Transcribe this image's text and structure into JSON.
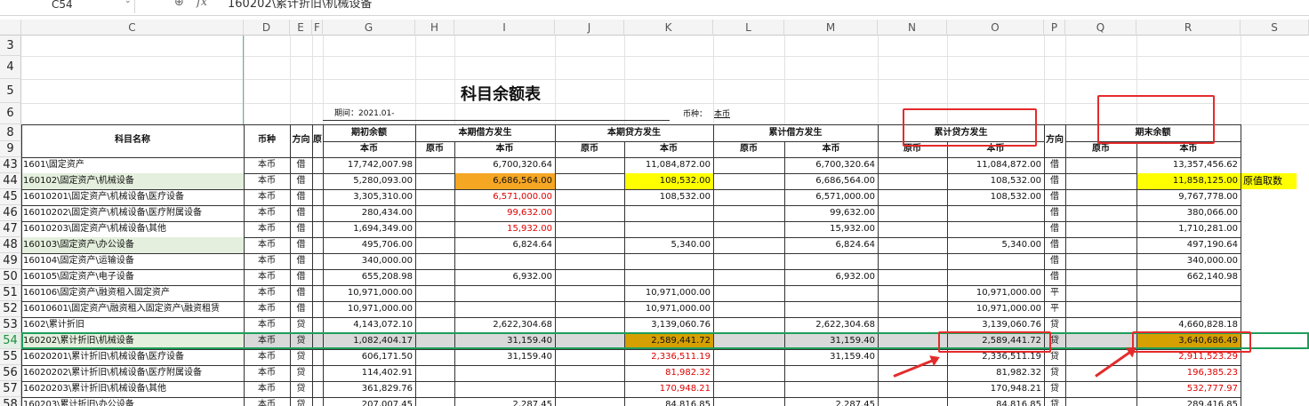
{
  "formula_bar": {
    "name_box": "C54",
    "formula": "160202\\累计折旧\\机械设备"
  },
  "columns": [
    "C",
    "D",
    "E",
    "F",
    "G",
    "H",
    "I",
    "J",
    "K",
    "L",
    "M",
    "N",
    "O",
    "P",
    "Q",
    "R",
    "S"
  ],
  "title": "科目余额表",
  "period_label": "期间：2021.01-",
  "currency_label": "币种：",
  "currency_value": "本币",
  "headers": {
    "subject_name": "科目名称",
    "currency": "币种",
    "direction": "方向",
    "direction2": "方向",
    "f_col": "原",
    "opening": "期初余额",
    "period_debit": "本期借方发生",
    "period_credit": "本期贷方发生",
    "cum_debit": "累计借方发生",
    "cum_credit": "累计贷方发生",
    "closing": "期末余额",
    "orig": "原币",
    "local": "本币"
  },
  "row_numbers_top": [
    "3",
    "4",
    "5",
    "6",
    "8",
    "9"
  ],
  "rows": [
    {
      "n": "43",
      "name": "1601\\固定资产",
      "cur": "本币",
      "dir": "借",
      "g": "17,742,007.98",
      "i": "6,700,320.64",
      "k": "11,084,872.00",
      "m": "6,700,320.64",
      "o": "11,084,872.00",
      "p": "借",
      "r": "13,357,456.62"
    },
    {
      "n": "44",
      "name": "160102\\固定资产\\机械设备",
      "cur": "本币",
      "dir": "借",
      "g": "5,280,093.00",
      "i": "6,686,564.00",
      "k": "108,532.00",
      "m": "6,686,564.00",
      "o": "108,532.00",
      "p": "借",
      "r": "11,858,125.00"
    },
    {
      "n": "45",
      "name": "16010201\\固定资产\\机械设备\\医疗设备",
      "cur": "本币",
      "dir": "借",
      "g": "3,305,310.00",
      "i": "6,571,000.00",
      "k": "108,532.00",
      "m": "6,571,000.00",
      "o": "108,532.00",
      "p": "借",
      "r": "9,767,778.00"
    },
    {
      "n": "46",
      "name": "16010202\\固定资产\\机械设备\\医疗附属设备",
      "cur": "本币",
      "dir": "借",
      "g": "280,434.00",
      "i": "99,632.00",
      "k": "",
      "m": "99,632.00",
      "o": "",
      "p": "借",
      "r": "380,066.00"
    },
    {
      "n": "47",
      "name": "16010203\\固定资产\\机械设备\\其他",
      "cur": "本币",
      "dir": "借",
      "g": "1,694,349.00",
      "i": "15,932.00",
      "k": "",
      "m": "15,932.00",
      "o": "",
      "p": "借",
      "r": "1,710,281.00"
    },
    {
      "n": "48",
      "name": "160103\\固定资产\\办公设备",
      "cur": "本币",
      "dir": "借",
      "g": "495,706.00",
      "i": "6,824.64",
      "k": "5,340.00",
      "m": "6,824.64",
      "o": "5,340.00",
      "p": "借",
      "r": "497,190.64"
    },
    {
      "n": "49",
      "name": "160104\\固定资产\\运输设备",
      "cur": "本币",
      "dir": "借",
      "g": "340,000.00",
      "i": "",
      "k": "",
      "m": "",
      "o": "",
      "p": "借",
      "r": "340,000.00"
    },
    {
      "n": "50",
      "name": "160105\\固定资产\\电子设备",
      "cur": "本币",
      "dir": "借",
      "g": "655,208.98",
      "i": "6,932.00",
      "k": "",
      "m": "6,932.00",
      "o": "",
      "p": "借",
      "r": "662,140.98"
    },
    {
      "n": "51",
      "name": "160106\\固定资产\\融资租入固定资产",
      "cur": "本币",
      "dir": "借",
      "g": "10,971,000.00",
      "i": "",
      "k": "10,971,000.00",
      "m": "",
      "o": "10,971,000.00",
      "p": "平",
      "r": ""
    },
    {
      "n": "52",
      "name": "16010601\\固定资产\\融资租入固定资产\\融资租赁",
      "cur": "本币",
      "dir": "借",
      "g": "10,971,000.00",
      "i": "",
      "k": "10,971,000.00",
      "m": "",
      "o": "10,971,000.00",
      "p": "平",
      "r": ""
    },
    {
      "n": "53",
      "name": "1602\\累计折旧",
      "cur": "本币",
      "dir": "贷",
      "g": "4,143,072.10",
      "i": "2,622,304.68",
      "k": "3,139,060.76",
      "m": "2,622,304.68",
      "o": "3,139,060.76",
      "p": "贷",
      "r": "4,660,828.18"
    },
    {
      "n": "54",
      "name": "160202\\累计折旧\\机械设备",
      "cur": "本币",
      "dir": "贷",
      "g": "1,082,404.17",
      "i": "31,159.40",
      "k": "2,589,441.72",
      "m": "31,159.40",
      "o": "2,589,441.72",
      "p": "贷",
      "r": "3,640,686.49"
    },
    {
      "n": "55",
      "name": "16020201\\累计折旧\\机械设备\\医疗设备",
      "cur": "本币",
      "dir": "贷",
      "g": "606,171.50",
      "i": "31,159.40",
      "k": "2,336,511.19",
      "m": "31,159.40",
      "o": "2,336,511.19",
      "p": "贷",
      "r": "2,911,523.29"
    },
    {
      "n": "56",
      "name": "16020202\\累计折旧\\机械设备\\医疗附属设备",
      "cur": "本币",
      "dir": "贷",
      "g": "114,402.91",
      "i": "",
      "k": "81,982.32",
      "m": "",
      "o": "81,982.32",
      "p": "贷",
      "r": "196,385.23"
    },
    {
      "n": "57",
      "name": "16020203\\累计折旧\\机械设备\\其他",
      "cur": "本币",
      "dir": "贷",
      "g": "361,829.76",
      "i": "",
      "k": "170,948.21",
      "m": "",
      "o": "170,948.21",
      "p": "贷",
      "r": "532,777.97"
    },
    {
      "n": "58",
      "name": "160203\\累计折旧\\办公设备",
      "cur": "本币",
      "dir": "贷",
      "g": "207,007.45",
      "i": "2,287.45",
      "k": "84,816.85",
      "m": "2,287.45",
      "o": "84,816.85",
      "p": "贷",
      "r": "289,416.85"
    }
  ],
  "note": "原值取数"
}
